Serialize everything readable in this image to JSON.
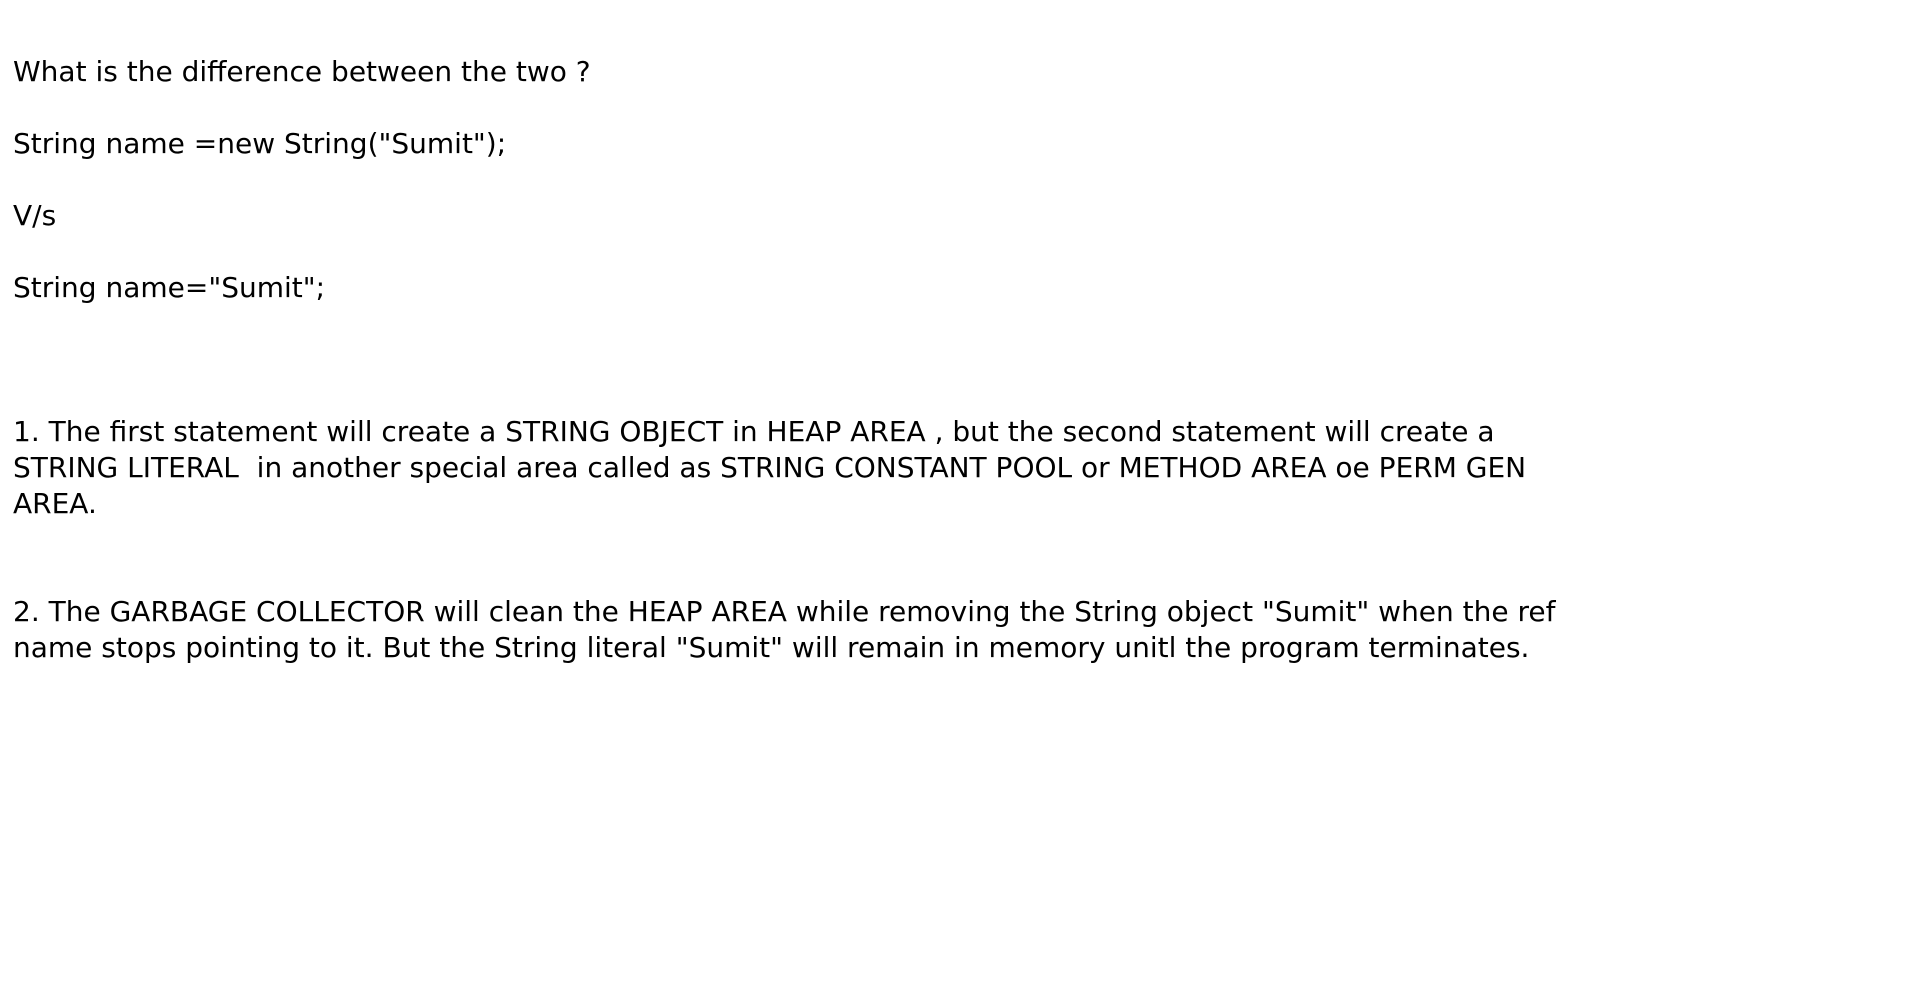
{
  "document": {
    "question": "What is the difference between the two ?",
    "code_first": "String name =new String(\"Sumit\");",
    "versus": "V/s",
    "code_second": "String name=\"Sumit\";",
    "point_1": {
      "line_1": "1. The first statement will create a STRING OBJECT in HEAP AREA , but the second statement will create a",
      "line_2": "STRING LITERAL  in another special area called as STRING CONSTANT POOL or METHOD AREA oe PERM GEN",
      "line_3": "AREA."
    },
    "point_2": {
      "line_1": "2. The GARBAGE COLLECTOR will clean the HEAP AREA while removing the String object \"Sumit\" when the ref",
      "line_2": "name stops pointing to it. But the String literal \"Sumit\" will remain in memory unitl the program terminates."
    }
  }
}
